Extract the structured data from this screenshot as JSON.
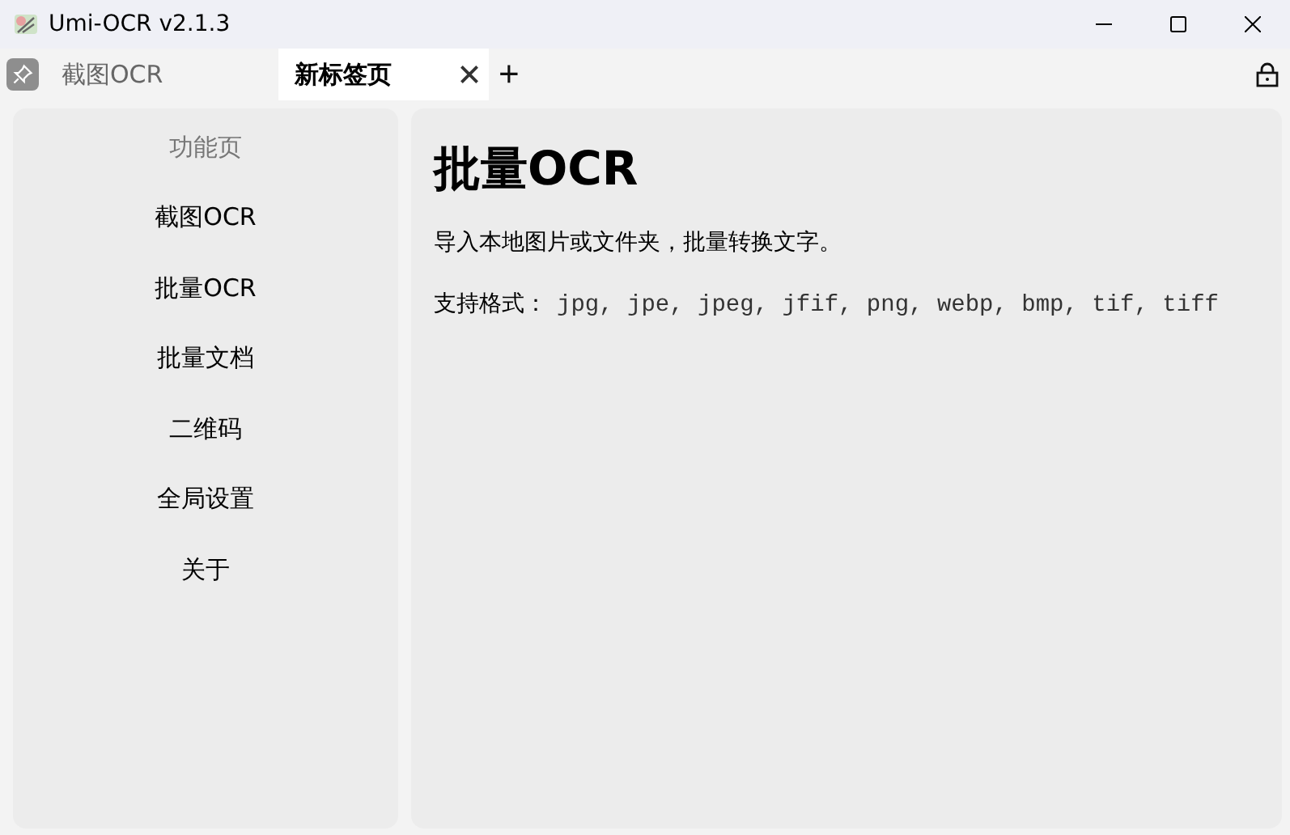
{
  "window": {
    "title": "Umi-OCR v2.1.3"
  },
  "tabs": [
    {
      "label": "截图OCR",
      "selected": false,
      "closable": false
    },
    {
      "label": "新标签页",
      "selected": true,
      "closable": true
    }
  ],
  "add_tab": "+",
  "sidebar": {
    "title": "功能页",
    "items": [
      "截图OCR",
      "批量OCR",
      "批量文档",
      "二维码",
      "全局设置",
      "关于"
    ]
  },
  "main": {
    "heading": "批量OCR",
    "description": "导入本地图片或文件夹，批量转换文字。",
    "formats_label": "支持格式：",
    "formats": "jpg, jpe, jpeg, jfif, png, webp, bmp, tif, tiff"
  }
}
